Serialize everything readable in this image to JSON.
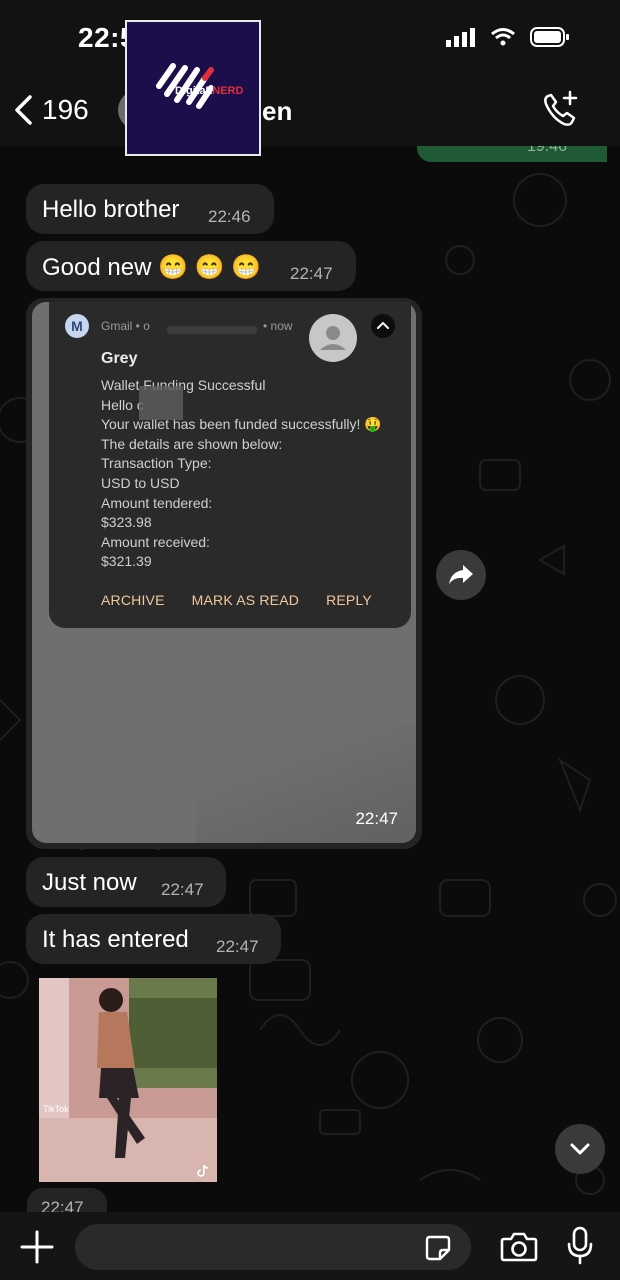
{
  "status_bar": {
    "time": "22:5"
  },
  "header": {
    "back_count": "196",
    "contact_name_partial": "en"
  },
  "overlay_logo": {
    "text_digital": "DigitaL",
    "text_nerd": "NERD"
  },
  "previous_message": {
    "time": "19:46"
  },
  "messages": [
    {
      "text": "Hello brother",
      "time": "22:46"
    },
    {
      "text": "Good new 😁 😁 😁",
      "time": "22:47"
    },
    {
      "text": "Just now",
      "time": "22:47"
    },
    {
      "text": "It has entered",
      "time": "22:47"
    }
  ],
  "image_message": {
    "time": "22:47",
    "notification": {
      "app_icon": "M",
      "app": "Gmail • o",
      "when": "• now",
      "sender": "Grey",
      "lines": [
        "Wallet Funding Successful",
        "Hello c",
        "Your wallet has been funded successfully! 🤑",
        "The details are shown below:",
        "Transaction Type:",
        "USD to USD",
        "Amount tendered:",
        "$323.98",
        "Amount received:",
        "$321.39"
      ],
      "actions": [
        "ARCHIVE",
        "MARK AS READ",
        "REPLY"
      ]
    }
  },
  "video_message": {
    "time": "22:47",
    "watermark": "TikTok"
  },
  "input": {
    "placeholder": ""
  },
  "icons": {
    "back": "chevron-left-icon",
    "call": "phone-plus-icon",
    "forward": "forward-icon",
    "scroll": "chevron-down-icon",
    "plus": "plus-icon",
    "sticker": "sticker-icon",
    "camera": "camera-icon",
    "mic": "mic-icon"
  },
  "colors": {
    "bubble": "#242424",
    "bar": "#121212",
    "action_text": "#f2c79b",
    "sent_bubble": "#1f5a35"
  }
}
